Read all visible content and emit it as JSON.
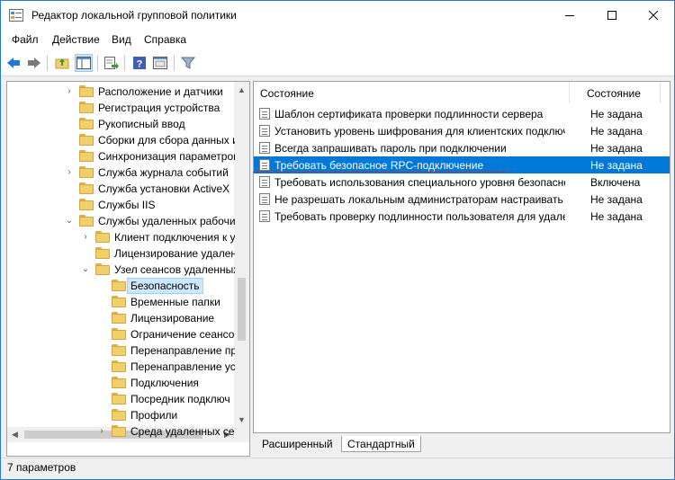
{
  "window": {
    "title": "Редактор локальной групповой политики",
    "minimize_icon": "minimize-icon",
    "maximize_icon": "maximize-icon",
    "close_icon": "close-icon"
  },
  "menu": [
    "Файл",
    "Действие",
    "Вид",
    "Справка"
  ],
  "toolbar": {
    "icons": [
      "back-arrow-icon",
      "forward-arrow-icon",
      "up-folder-icon",
      "show-hide-tree-icon",
      "export-list-icon",
      "help-icon",
      "extended-view-icon",
      "filter-icon"
    ],
    "colors": {
      "arrow": "#1f7ad1",
      "accent": "#0078d7"
    }
  },
  "tree": {
    "items": [
      {
        "label": "Расположение и датчики",
        "expander": "›"
      },
      {
        "label": "Регистрация устройства",
        "expander": ""
      },
      {
        "label": "Рукописный ввод",
        "expander": ""
      },
      {
        "label": "Сборки для сбора данных и",
        "expander": ""
      },
      {
        "label": "Синхронизация параметров",
        "expander": ""
      },
      {
        "label": "Служба журнала событий",
        "expander": "›"
      },
      {
        "label": "Служба установки ActiveX",
        "expander": ""
      },
      {
        "label": "Службы IIS",
        "expander": ""
      },
      {
        "label": "Службы удаленных рабочи",
        "expander": "⌄"
      },
      {
        "label": "Клиент подключения к у",
        "expander": "›"
      },
      {
        "label": "Лицензирование удален",
        "expander": ""
      },
      {
        "label": "Узел сеансов удаленных",
        "expander": "⌄"
      },
      {
        "label": "Безопасность",
        "expander": "",
        "selected": true
      },
      {
        "label": "Временные папки",
        "expander": ""
      },
      {
        "label": "Лицензирование",
        "expander": ""
      },
      {
        "label": "Ограничение сеансов",
        "expander": ""
      },
      {
        "label": "Перенаправление пр",
        "expander": ""
      },
      {
        "label": "Перенаправление ус",
        "expander": ""
      },
      {
        "label": "Подключения",
        "expander": ""
      },
      {
        "label": "Посредник подключ",
        "expander": ""
      },
      {
        "label": "Профили",
        "expander": ""
      },
      {
        "label": "Среда удаленных се",
        "expander": "›"
      }
    ]
  },
  "list": {
    "columns": {
      "name": "Состояние",
      "state": "Состояние"
    },
    "rows": [
      {
        "name": "Шаблон сертификата проверки подлинности сервера",
        "state": "Не задана"
      },
      {
        "name": "Установить уровень шифрования для клиентских подключений",
        "state": "Не задана"
      },
      {
        "name": "Всегда запрашивать пароль при подключении",
        "state": "Не задана"
      },
      {
        "name": "Требовать безопасное RPC-подключение",
        "state": "Не задана",
        "selected": true
      },
      {
        "name": "Требовать использования специального уровня безопасности",
        "state": "Включена"
      },
      {
        "name": "Не разрешать локальным администраторам настраивать разрешения",
        "state": "Не задана"
      },
      {
        "name": "Требовать проверку подлинности пользователя для удаленных подключений",
        "state": "Не задана"
      }
    ]
  },
  "tabs": [
    "Расширенный",
    "Стандартный"
  ],
  "status": {
    "text": "7 параметров"
  }
}
